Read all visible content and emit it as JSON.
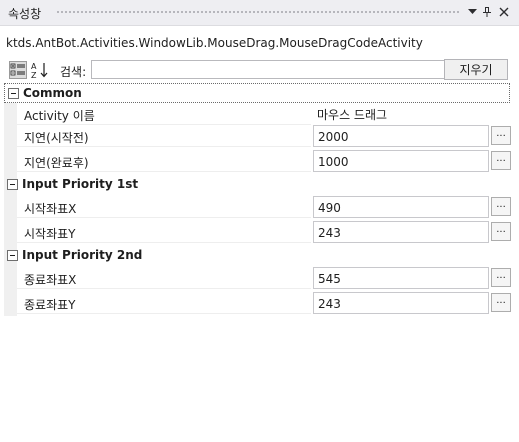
{
  "panel": {
    "title": "속성창",
    "buttons": {
      "dropdown": "dropdown",
      "pin": "pin",
      "close": "close"
    }
  },
  "type_name": "ktds.AntBot.Activities.WindowLib.MouseDrag.MouseDragCodeActivity",
  "toolbar": {
    "categorized_icon": "categorized-view-icon",
    "alphabetical_icon": "alphabetical-sort-icon",
    "search_label": "검색:",
    "search_value": "",
    "search_placeholder": "",
    "clear_label": "지우기"
  },
  "categories": [
    {
      "label": "Common",
      "properties": [
        {
          "name": "Activity 이름",
          "value": "마우스 드래그",
          "editable": false
        },
        {
          "name": "지연(시작전)",
          "value": "2000",
          "editable": true
        },
        {
          "name": "지연(완료후)",
          "value": "1000",
          "editable": true
        }
      ]
    },
    {
      "label": "Input Priority 1st",
      "properties": [
        {
          "name": "시작좌표X",
          "value": "490",
          "editable": true
        },
        {
          "name": "시작좌표Y",
          "value": "243",
          "editable": true
        }
      ]
    },
    {
      "label": "Input Priority 2nd",
      "properties": [
        {
          "name": "종료좌표X",
          "value": "545",
          "editable": true
        },
        {
          "name": "종료좌표Y",
          "value": "243",
          "editable": true
        }
      ]
    }
  ],
  "ellipsis_label": "..."
}
